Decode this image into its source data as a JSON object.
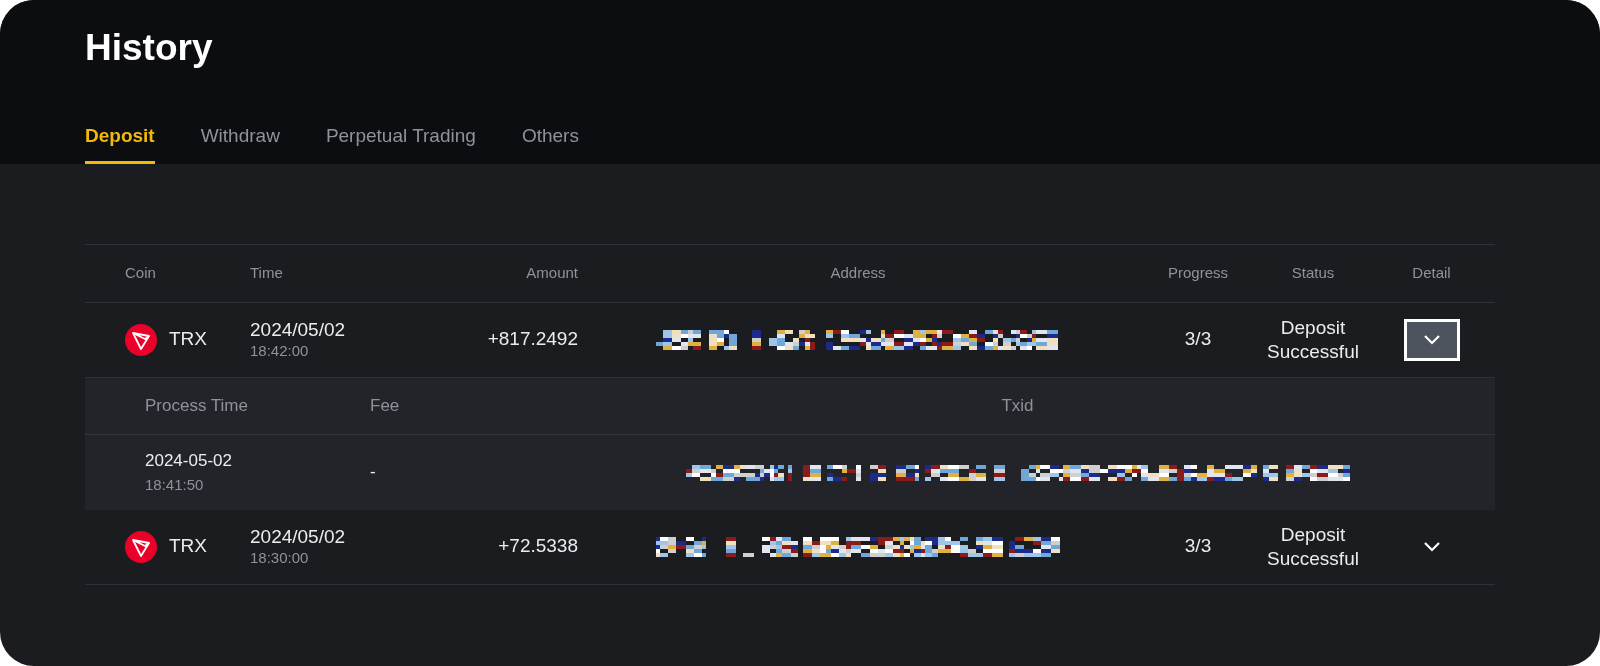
{
  "title": "History",
  "tabs": [
    {
      "label": "Deposit",
      "selected": true
    },
    {
      "label": "Withdraw",
      "selected": false
    },
    {
      "label": "Perpetual Trading",
      "selected": false
    },
    {
      "label": "Others",
      "selected": false
    }
  ],
  "table": {
    "columns": [
      "Coin",
      "Time",
      "Amount",
      "Address",
      "Progress",
      "Status",
      "Detail"
    ],
    "rows": [
      {
        "coin": "TRX",
        "date": "2024/05/02",
        "time": "18:42:00",
        "amount": "+817.2492",
        "progress": "3/3",
        "status": "Deposit Successful",
        "expanded": true,
        "detail": {
          "columns": [
            "Process Time",
            "Fee",
            "Txid"
          ],
          "date": "2024-05-02",
          "time": "18:41:50",
          "fee": "-"
        }
      },
      {
        "coin": "TRX",
        "date": "2024/05/02",
        "time": "18:30:00",
        "amount": "+72.5338",
        "progress": "3/3",
        "status": "Deposit Successful",
        "expanded": false
      }
    ]
  }
}
